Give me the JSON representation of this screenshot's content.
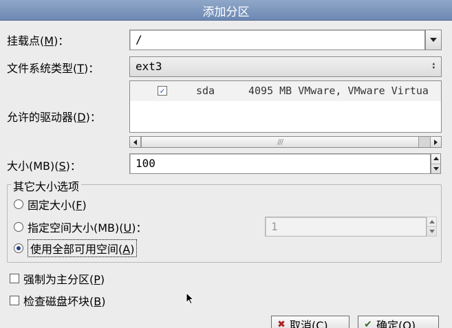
{
  "window": {
    "title": "添加分区"
  },
  "mount_point": {
    "label": "挂载点(",
    "mnemonic": "M",
    "suffix": ")：",
    "value": "/"
  },
  "fs_type": {
    "label": "文件系统类型(",
    "mnemonic": "T",
    "suffix": ")：",
    "value": "ext3"
  },
  "drives": {
    "label": "允许的驱动器(",
    "mnemonic": "D",
    "suffix": ")：",
    "rows": [
      {
        "checked": "✓",
        "name": "sda",
        "desc": "4095 MB VMware, VMware Virtua"
      }
    ]
  },
  "size": {
    "label": "大小(MB)(",
    "mnemonic": "S",
    "suffix": ")：",
    "value": "100"
  },
  "other_options": {
    "legend": "其它大小选项",
    "fixed": {
      "label": "固定大小(",
      "mnemonic": "F",
      "suffix": ")"
    },
    "fill_to": {
      "label": "指定空间大小(MB)(",
      "mnemonic": "U",
      "suffix": ")：",
      "value": "1"
    },
    "fill_all": {
      "label": "使用全部可用空间(",
      "mnemonic": "A",
      "suffix": ")"
    },
    "selected": "fill_all"
  },
  "force_primary": {
    "label": "强制为主分区(",
    "mnemonic": "P",
    "suffix": ")"
  },
  "bad_blocks": {
    "label": "检查磁盘坏块(",
    "mnemonic": "B",
    "suffix": ")"
  },
  "buttons": {
    "cancel": {
      "label": "取消(",
      "mnemonic": "C",
      "suffix": ")"
    },
    "ok": {
      "label": "确定(",
      "mnemonic": "O",
      "suffix": ")"
    }
  },
  "scroll": {
    "thumb_grip": "///"
  },
  "colors": {
    "title_bar": "#7a93bd",
    "radio_dot": "#1f3f8a"
  }
}
